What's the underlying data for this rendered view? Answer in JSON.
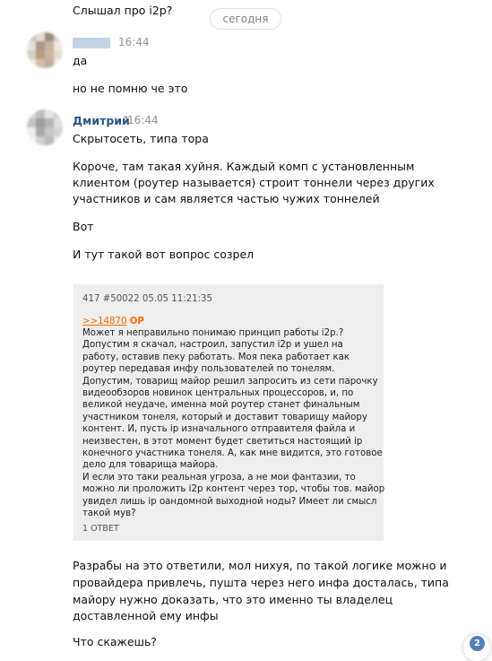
{
  "messages": {
    "top_line": "Слышал про i2p?",
    "date_separator": "сегодня",
    "group1": {
      "time": "16:44",
      "lines": [
        "да",
        "но не помню че это"
      ]
    },
    "group2": {
      "author": "Дмитрий",
      "time": "16:44",
      "line1": "Скрытосеть, типа тора",
      "paragraph": [
        "Короче, там такая хуйня. Каждый комп с установленным",
        "клиентом (роутер называется) строит тоннели через других",
        "участников и сам является частью чужих тоннелей"
      ],
      "vot": "Вот",
      "question_line": "И тут такой вот вопрос созрел",
      "after_quote": [
        "Разрабы на это ответили, мол нихуя, по такой логике можно и",
        "провайдера привлечь, пушта через него инфа досталась, типа",
        "майору нужно доказать, что это именно ты владелец",
        "доставленной ему инфы"
      ],
      "last_line": "Что скажешь?"
    }
  },
  "quote_post": {
    "header": "417 #50022 05.05 11:21:35",
    "reply_link": ">>14870",
    "op_tag": "OP",
    "body": [
      "Может я неправильно понимаю принцип работы i2p.?",
      "Допустим я скачал, настроил, запустил i2p и ушел на",
      "работу, оставив пеку работать. Моя пека работает как",
      "роутер передавая инфу пользователей по тонелям.",
      "Допустим, товарищ майор решил запросить из сети парочку",
      "видеообзоров новинок центральных процессоров, и, по",
      "великой неудаче, именна мой роутер станет финальным",
      "участником тонеля, который и доставит товарищу майору",
      "контент. И, пусть ip изначального отправителя файла и",
      "неизвестен, в этот момент будет светиться настоящий ip",
      "конечного участника тонеля. А, как мне видится, это готовое",
      "дело для товарища майора.",
      "И если это таки реальная угроза, а не мои фантазии, то",
      "можно ли проложить i2p контент через тор, чтобы тов. майор",
      "увидел лишь ip оандомной выходной ноды? Имеет ли смысл",
      "такой мув?"
    ],
    "footer": "1 ОТВЕТ"
  },
  "scroll_badge": {
    "count": "2"
  },
  "colors": {
    "link": "#2a5885",
    "accent_orange": "#ff6600",
    "badge": "#5181b8",
    "quote_bg": "#eeeeee"
  }
}
